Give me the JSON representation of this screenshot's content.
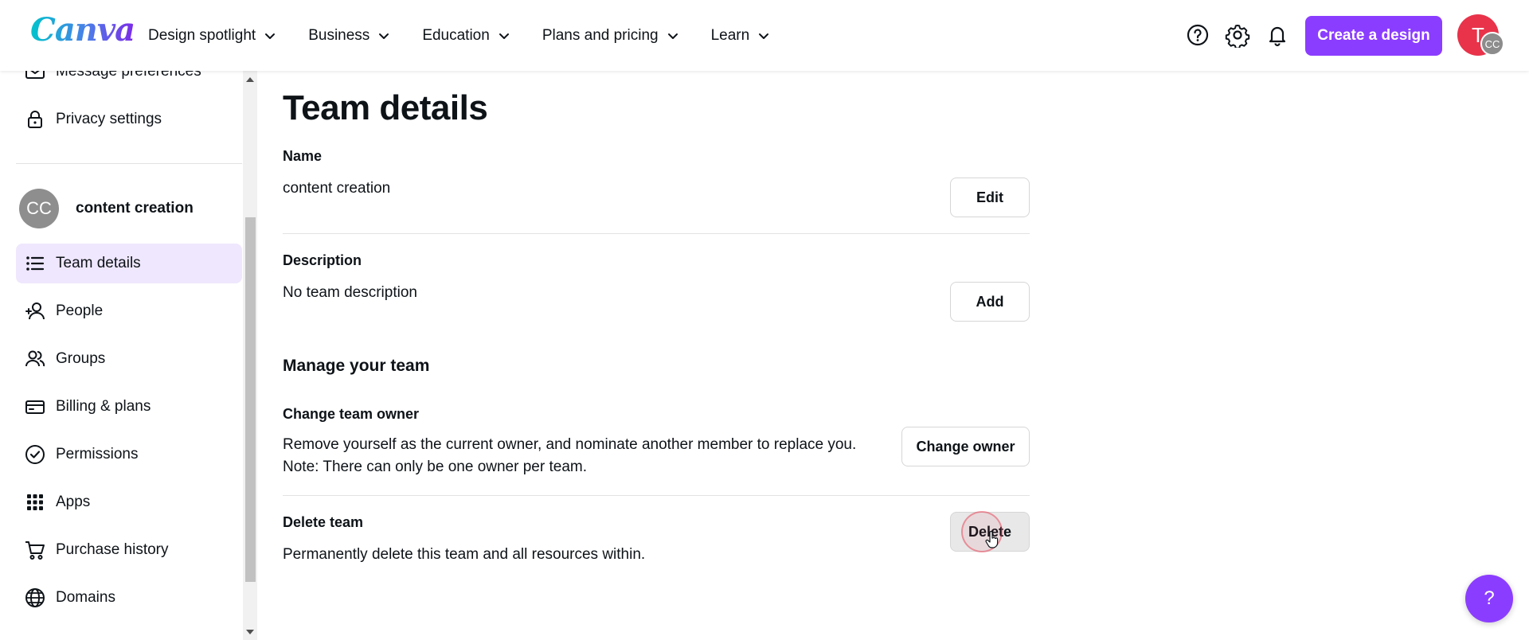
{
  "header": {
    "logo_text": "Canva",
    "nav": [
      {
        "label": "Design spotlight"
      },
      {
        "label": "Business"
      },
      {
        "label": "Education"
      },
      {
        "label": "Plans and pricing"
      },
      {
        "label": "Learn"
      }
    ],
    "create_button": "Create a design",
    "avatar_initial": "T",
    "avatar_team_initials": "CC",
    "icons": [
      "help-icon",
      "settings-icon",
      "notifications-icon"
    ],
    "accent_color": "#8b3dff"
  },
  "sidebar": {
    "top_items": [
      {
        "label": "Message preferences",
        "icon": "envelope-icon"
      },
      {
        "label": "Privacy settings",
        "icon": "lock-icon"
      }
    ],
    "team": {
      "initials": "CC",
      "name": "content creation"
    },
    "items": [
      {
        "label": "Team details",
        "icon": "list-icon",
        "active": true
      },
      {
        "label": "People",
        "icon": "people-icon"
      },
      {
        "label": "Groups",
        "icon": "groups-icon"
      },
      {
        "label": "Billing & plans",
        "icon": "card-icon"
      },
      {
        "label": "Permissions",
        "icon": "check-circle-icon"
      },
      {
        "label": "Apps",
        "icon": "grid-icon"
      },
      {
        "label": "Purchase history",
        "icon": "cart-icon"
      },
      {
        "label": "Domains",
        "icon": "globe-icon"
      }
    ]
  },
  "main": {
    "title": "Team details",
    "name": {
      "label": "Name",
      "value": "content creation",
      "button": "Edit"
    },
    "description": {
      "label": "Description",
      "value": "No team description",
      "button": "Add"
    },
    "manage_title": "Manage your team",
    "change_owner": {
      "label": "Change team owner",
      "line1": "Remove yourself as the current owner, and nominate another member to replace you.",
      "line2": "Note: There can only be one owner per team.",
      "button": "Change owner"
    },
    "delete_team": {
      "label": "Delete team",
      "value": "Permanently delete this team and all resources within.",
      "button": "Delete"
    }
  },
  "help_fab": "?"
}
